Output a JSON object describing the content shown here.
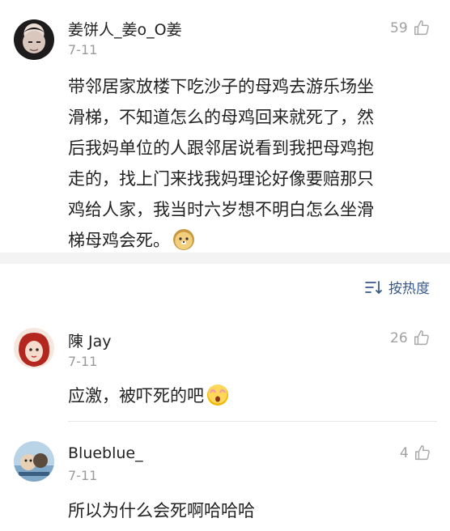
{
  "comments": [
    {
      "username": "姜饼人_姜o_O姜",
      "date": "7-11",
      "likes": "59",
      "text_lines": [
        "带邻居家放楼下吃沙子的母鸡去游乐场坐",
        "滑梯，不知道怎么的母鸡回来就死了，然",
        "后我妈单位的人跟邻居说看到我把母鸡抱",
        "走的，找上门来找我妈理论好像要赔那只",
        "鸡给人家，我当时六岁想不明白怎么坐滑",
        "梯母鸡会死。"
      ],
      "emoji": "doge-emoji"
    },
    {
      "username": "陳 Jay",
      "date": "7-11",
      "likes": "26",
      "text": "应激，被吓死的吧",
      "emoji": "scared-emoji"
    },
    {
      "username": "Blueblue_",
      "date": "7-11",
      "likes": "4",
      "text": "所以为什么会死啊哈哈哈"
    }
  ],
  "sort": {
    "label": "按热度",
    "icon": "sort-icon"
  },
  "colors": {
    "accent": "#3a5a8a",
    "muted": "#9a9a9a",
    "band": "#f3f3f3"
  }
}
